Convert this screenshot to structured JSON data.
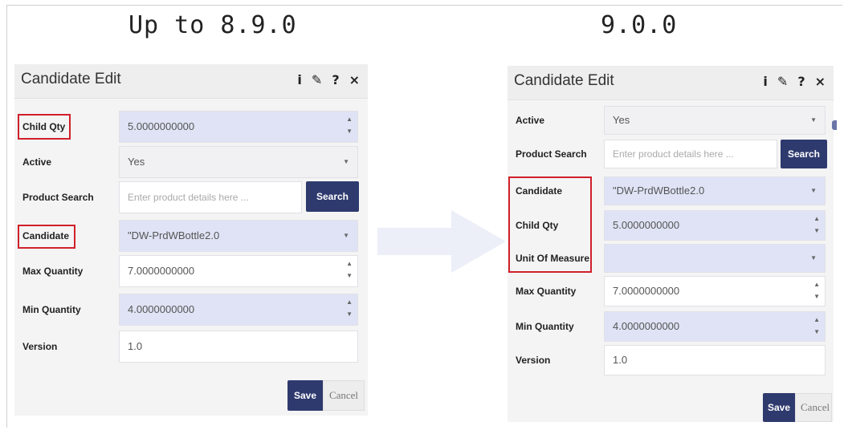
{
  "headings": {
    "left": "Up to 8.9.0",
    "right": "9.0.0"
  },
  "old_dialog": {
    "title": "Candidate Edit",
    "header_icons": [
      "i",
      "✎",
      "?",
      "×"
    ],
    "fields": {
      "child_qty": {
        "label": "Child Qty",
        "value": "5.0000000000"
      },
      "active": {
        "label": "Active",
        "value": "Yes"
      },
      "product_search": {
        "label": "Product Search",
        "placeholder": "Enter product details here ...",
        "button": "Search"
      },
      "candidate": {
        "label": "Candidate",
        "value": "\"DW-PrdWBottle2.0"
      },
      "max_quantity": {
        "label": "Max Quantity",
        "value": "7.0000000000"
      },
      "min_quantity": {
        "label": "Min Quantity",
        "value": "4.0000000000"
      },
      "version": {
        "label": "Version",
        "value": "1.0"
      }
    },
    "save_label": "Save",
    "cancel_label": "Cancel"
  },
  "new_dialog": {
    "title": "Candidate Edit",
    "header_icons": [
      "i",
      "✎",
      "?",
      "×"
    ],
    "fields": {
      "active": {
        "label": "Active",
        "value": "Yes"
      },
      "product_search": {
        "label": "Product Search",
        "placeholder": "Enter product details here ...",
        "button": "Search"
      },
      "candidate": {
        "label": "Candidate",
        "value": "\"DW-PrdWBottle2.0"
      },
      "child_qty": {
        "label": "Child Qty",
        "value": "5.0000000000"
      },
      "unit_of_measure": {
        "label": "Unit Of Measure",
        "value": ""
      },
      "max_quantity": {
        "label": "Max Quantity",
        "value": "7.0000000000"
      },
      "min_quantity": {
        "label": "Min Quantity",
        "value": "4.0000000000"
      },
      "version": {
        "label": "Version",
        "value": "1.0"
      }
    },
    "save_label": "Save",
    "cancel_label": "Cancel"
  },
  "colors": {
    "highlight": "#d0202a",
    "primary_button": "#2e3a6e",
    "field_blue": "#dfe3f5",
    "arrow": "#eceef8"
  }
}
